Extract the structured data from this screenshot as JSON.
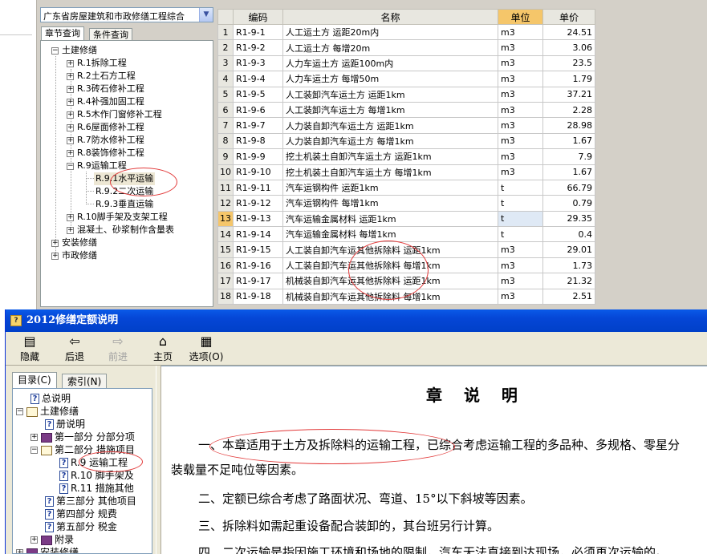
{
  "top": {
    "combo_value": "广东省房屋建筑和市政修缮工程综合",
    "tabs": [
      "章节查询",
      "条件查询"
    ],
    "tree": [
      {
        "label": "土建修缮",
        "mark": "−",
        "level": 0
      },
      {
        "label": "R.1拆除工程",
        "mark": "+",
        "level": 1
      },
      {
        "label": "R.2土石方工程",
        "mark": "+",
        "level": 1
      },
      {
        "label": "R.3砖石修补工程",
        "mark": "+",
        "level": 1
      },
      {
        "label": "R.4补强加固工程",
        "mark": "+",
        "level": 1
      },
      {
        "label": "R.5木作门窗修补工程",
        "mark": "+",
        "level": 1
      },
      {
        "label": "R.6屋面修补工程",
        "mark": "+",
        "level": 1
      },
      {
        "label": "R.7防水修补工程",
        "mark": "+",
        "level": 1
      },
      {
        "label": "R.8装饰修补工程",
        "mark": "+",
        "level": 1
      },
      {
        "label": "R.9运输工程",
        "mark": "−",
        "level": 1
      },
      {
        "label": "R.9.1水平运输",
        "mark": "",
        "level": 2
      },
      {
        "label": "R.9.2二次运输",
        "mark": "",
        "level": 2
      },
      {
        "label": "R.9.3垂直运输",
        "mark": "",
        "level": 2
      },
      {
        "label": "R.10脚手架及支架工程",
        "mark": "+",
        "level": 1
      },
      {
        "label": "混凝土、砂浆制作含量表",
        "mark": "+",
        "level": 1
      },
      {
        "label": "安装修缮",
        "mark": "+",
        "level": 0
      },
      {
        "label": "市政修缮",
        "mark": "+",
        "level": 0
      }
    ],
    "grid": {
      "headers": [
        "",
        "编码",
        "名称",
        "单位",
        "单价"
      ],
      "rows": [
        [
          "1",
          "R1-9-1",
          "人工运土方 运距20m内",
          "m3",
          "24.51"
        ],
        [
          "2",
          "R1-9-2",
          "人工运土方 每增20m",
          "m3",
          "3.06"
        ],
        [
          "3",
          "R1-9-3",
          "人力车运土方 运距100m内",
          "m3",
          "23.5"
        ],
        [
          "4",
          "R1-9-4",
          "人力车运土方 每增50m",
          "m3",
          "1.79"
        ],
        [
          "5",
          "R1-9-5",
          "人工装卸汽车运土方 运距1km",
          "m3",
          "37.21"
        ],
        [
          "6",
          "R1-9-6",
          "人工装卸汽车运土方 每增1km",
          "m3",
          "2.28"
        ],
        [
          "7",
          "R1-9-7",
          "人力装自卸汽车运土方 运距1km",
          "m3",
          "28.98"
        ],
        [
          "8",
          "R1-9-8",
          "人力装自卸汽车运土方 每增1km",
          "m3",
          "1.67"
        ],
        [
          "9",
          "R1-9-9",
          "挖土机装土自卸汽车运土方 运距1km",
          "m3",
          "7.9"
        ],
        [
          "10",
          "R1-9-10",
          "挖土机装土自卸汽车运土方 每增1km",
          "m3",
          "1.67"
        ],
        [
          "11",
          "R1-9-11",
          "汽车运钢构件 运距1km",
          "t",
          "66.79"
        ],
        [
          "12",
          "R1-9-12",
          "汽车运钢构件 每增1km",
          "t",
          "0.79"
        ],
        [
          "13",
          "R1-9-13",
          "汽车运输金属材料 运距1km",
          "t",
          "29.35"
        ],
        [
          "14",
          "R1-9-14",
          "汽车运输金属材料 每增1km",
          "t",
          "0.4"
        ],
        [
          "15",
          "R1-9-15",
          "人工装自卸汽车运其他拆除料 运距1km",
          "m3",
          "29.01"
        ],
        [
          "16",
          "R1-9-16",
          "人工装自卸汽车运其他拆除料 每增1km",
          "m3",
          "1.73"
        ],
        [
          "17",
          "R1-9-17",
          "机械装自卸汽车运其他拆除料 运距1km",
          "m3",
          "21.32"
        ],
        [
          "18",
          "R1-9-18",
          "机械装自卸汽车运其他拆除料 每增1km",
          "m3",
          "2.51"
        ]
      ],
      "current_row": 13
    }
  },
  "help": {
    "title": "2012修缮定额说明",
    "toolbar": [
      {
        "label": "隐藏",
        "icon": "hide-icon",
        "glyph": "▤",
        "enabled": true
      },
      {
        "label": "后退",
        "icon": "back-arrow-icon",
        "glyph": "⇦",
        "enabled": true
      },
      {
        "label": "前进",
        "icon": "forward-arrow-icon",
        "glyph": "⇨",
        "enabled": false
      },
      {
        "label": "主页",
        "icon": "home-icon",
        "glyph": "⌂",
        "enabled": true
      },
      {
        "label": "选项(O)",
        "icon": "options-icon",
        "glyph": "▦",
        "enabled": true
      }
    ],
    "nav_tabs": [
      "目录(C)",
      "索引(N)"
    ],
    "nav_tree": [
      {
        "label": "总说明",
        "type": "page",
        "mark": ""
      },
      {
        "label": "土建修缮",
        "type": "book-open",
        "mark": "−"
      },
      {
        "label": "册说明",
        "type": "page",
        "mark": ""
      },
      {
        "label": "第一部分 分部分项",
        "type": "book",
        "mark": "+"
      },
      {
        "label": "第二部分 措施项目",
        "type": "book-open",
        "mark": "−"
      },
      {
        "label": "R.9 运输工程",
        "type": "page",
        "mark": ""
      },
      {
        "label": "R.10 脚手架及",
        "type": "page",
        "mark": ""
      },
      {
        "label": "R.11 措施其他",
        "type": "page",
        "mark": ""
      },
      {
        "label": "第三部分 其他项目",
        "type": "page",
        "mark": ""
      },
      {
        "label": "第四部分 规费",
        "type": "page",
        "mark": ""
      },
      {
        "label": "第五部分 税金",
        "type": "page",
        "mark": ""
      },
      {
        "label": "附录",
        "type": "book",
        "mark": "+"
      },
      {
        "label": "安装修缮",
        "type": "book",
        "mark": "+"
      }
    ],
    "content": {
      "heading": "章 说 明",
      "paragraphs": [
        "一、本章适用于土方及拆除料的运输工程，已综合考虑运输工程的多品种、多规格、零星分",
        "装载量不足吨位等因素。",
        "二、定额已综合考虑了路面状况、弯道、15°以下斜坡等因素。",
        "三、拆除料如需起重设备配合装卸的，其台班另行计算。",
        "四、二次运输是指因施工环境和场地的限制，汽车无法直接到达现场，必须再次运输的。"
      ]
    }
  }
}
